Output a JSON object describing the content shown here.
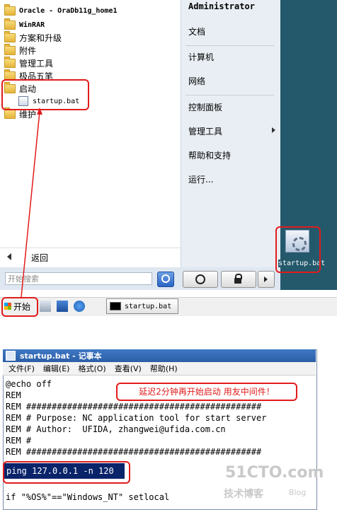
{
  "start_menu": {
    "programs": [
      {
        "label": "Oracle - OraDb11g_home1",
        "type": "folder"
      },
      {
        "label": "WinRAR",
        "type": "folder"
      },
      {
        "label": "方案和升级",
        "type": "folder"
      },
      {
        "label": "附件",
        "type": "folder"
      },
      {
        "label": "管理工具",
        "type": "folder"
      },
      {
        "label": "极品五笔",
        "type": "folder"
      },
      {
        "label": "启动",
        "type": "folder"
      },
      {
        "label": "startup.bat",
        "type": "file"
      },
      {
        "label": "维护",
        "type": "folder"
      }
    ],
    "back_label": "返回",
    "search_placeholder": "开始搜索",
    "right_items": {
      "user": "Administrator",
      "documents": "文档",
      "computer": "计算机",
      "network": "网络",
      "control_panel": "控制面板",
      "admin_tools": "管理工具",
      "help": "帮助和支持",
      "run": "运行..."
    }
  },
  "taskbar": {
    "start_label": "开始",
    "task_item": "startup.bat"
  },
  "desktop_icon_label": "startup.bat",
  "notepad": {
    "title": "startup.bat - 记事本",
    "menu": [
      "文件(F)",
      "编辑(E)",
      "格式(O)",
      "查看(V)",
      "帮助(H)"
    ],
    "lines": [
      "@echo off",
      "REM",
      "REM ##############################################",
      "REM # Purpose: NC application tool for start server",
      "REM # Author:  UFIDA, zhangwei@ufida.com.cn",
      "REM #",
      "REM ##############################################"
    ],
    "ping_line": "ping 127.0.0.1 -n 120",
    "last_line": "if \"%OS%\"==\"Windows_NT\" setlocal",
    "annotation": "延迟2分钟再开始启动 用友中间件！"
  },
  "watermark": {
    "site": "51CTO.com",
    "sub": "技术博客",
    "blog": "Blog"
  },
  "colors": {
    "annotation": "#e21b1b",
    "start_blue": "#24596c",
    "highlight": "#0a246a"
  }
}
